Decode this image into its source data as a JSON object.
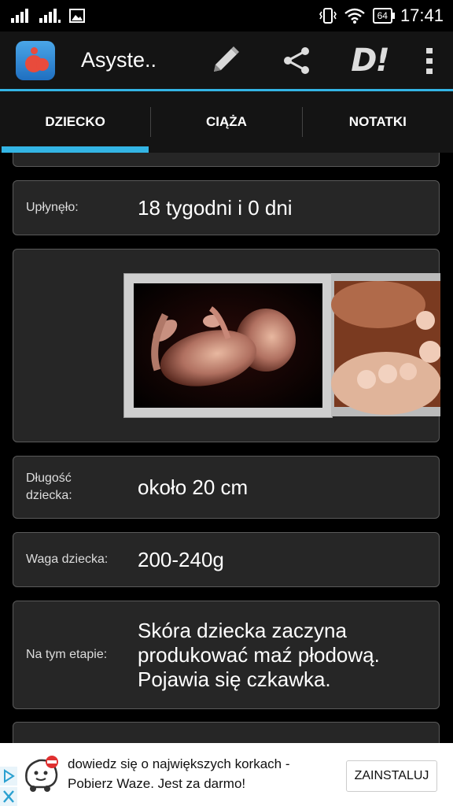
{
  "status_bar": {
    "time": "17:41",
    "battery": "64"
  },
  "app_bar": {
    "title": "Asyste.."
  },
  "tabs": [
    {
      "label": "DZIECKO",
      "active": true
    },
    {
      "label": "CIĄŻA",
      "active": false
    },
    {
      "label": "NOTATKI",
      "active": false
    }
  ],
  "rows": {
    "elapsed": {
      "label": "Upłynęło:",
      "value": "18 tygodni i 0 dni"
    },
    "length": {
      "label": "Długość dziecka:",
      "value": "około 20 cm"
    },
    "weight": {
      "label": "Waga dziecka:",
      "value": "200-240g"
    },
    "stage": {
      "label": "Na tym etapie:",
      "value": "Skóra dziecka zaczyna produkować maź płodową. Pojawia się czkawka."
    }
  },
  "ad": {
    "text": "dowiedz się o największych korkach - Pobierz Waze. Jest za darmo!",
    "button": "ZAINSTALUJ"
  },
  "colors": {
    "accent": "#33b5e5",
    "card_bg": "#262626",
    "card_border": "#5a5a5a"
  }
}
